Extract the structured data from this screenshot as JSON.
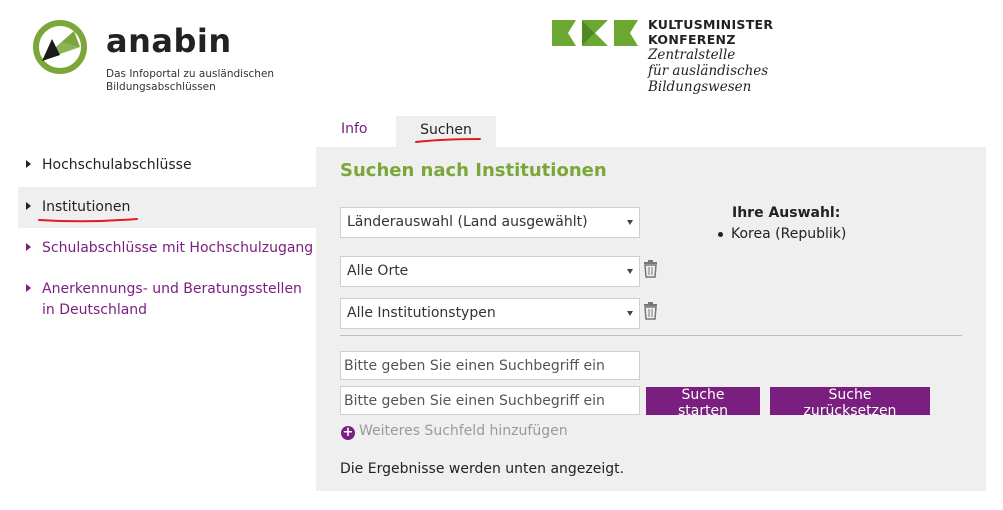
{
  "header": {
    "brand_name": "anabin",
    "brand_subtitle": "Das Infoportal zu ausländischen Bildungsabschlüssen",
    "kmk_line1": "KULTUSMINISTER",
    "kmk_line2": "KONFERENZ",
    "kmk_italic1": "Zentralstelle",
    "kmk_italic2": "für ausländisches",
    "kmk_italic3": "Bildungswesen"
  },
  "tabs": [
    {
      "label": "Info"
    },
    {
      "label": "Suchen"
    }
  ],
  "sidebar": {
    "items": [
      {
        "label": "Hochschulabschlüsse"
      },
      {
        "label": "Institutionen"
      },
      {
        "label": "Schulabschlüsse mit Hochschulzugang"
      },
      {
        "label": "Anerkennungs- und Beratungsstellen in Deutschland"
      }
    ]
  },
  "main": {
    "title": "Suchen nach Institutionen",
    "selects": [
      {
        "value": "Länderauswahl (Land ausgewählt)"
      },
      {
        "value": "Alle Orte"
      },
      {
        "value": "Alle Institutionstypen"
      }
    ],
    "selection_heading": "Ihre Auswahl:",
    "selection_items": [
      "Korea (Republik)"
    ],
    "search_placeholder": "Bitte geben Sie einen Suchbegriff ein",
    "btn_start": "Suche starten",
    "btn_reset": "Suche zurücksetzen",
    "add_field": "Weiteres Suchfeld hinzufügen",
    "results_note": "Die Ergebnisse werden unten angezeigt."
  },
  "colors": {
    "accent_purple": "#7a1f80",
    "title_green": "#7aa63a",
    "kmk_green": "#6aa832",
    "annotation_red": "#e01b1b"
  }
}
